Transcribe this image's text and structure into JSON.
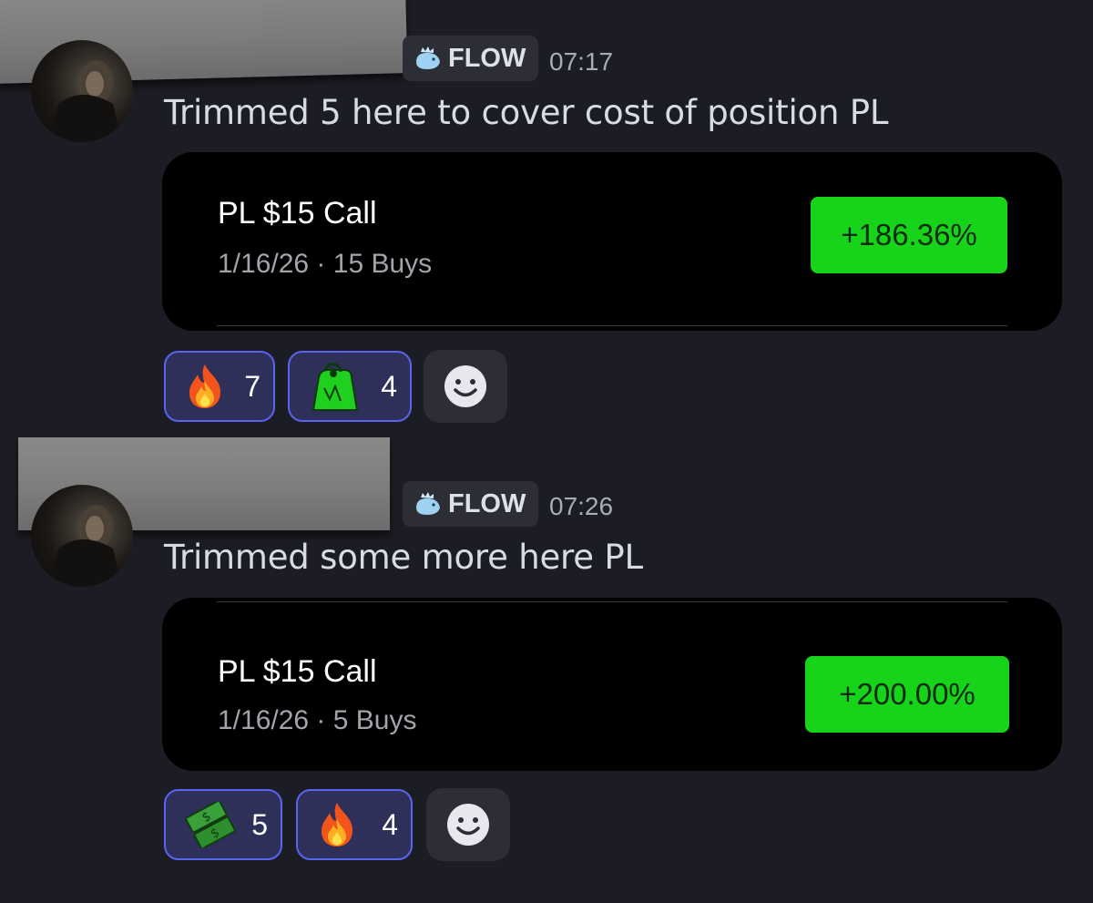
{
  "messages": [
    {
      "role_badge": "FLOW",
      "timestamp": "07:17",
      "text": "Trimmed 5 here to cover cost of position PL",
      "card": {
        "title": "PL $15 Call",
        "subtitle": "1/16/26 · 15 Buys",
        "change": "+186.36%"
      },
      "reactions": [
        {
          "emoji": "fire-emoji",
          "count": "7"
        },
        {
          "emoji": "money-bag-emoji",
          "count": "4"
        }
      ]
    },
    {
      "role_badge": "FLOW",
      "timestamp": "07:26",
      "text": "Trimmed some more here PL",
      "card": {
        "title": "PL $15 Call",
        "subtitle": "1/16/26 · 5 Buys",
        "change": "+200.00%"
      },
      "reactions": [
        {
          "emoji": "money-with-wings-emoji",
          "count": "5"
        },
        {
          "emoji": "fire-emoji",
          "count": "4"
        }
      ]
    }
  ],
  "colors": {
    "background": "#1c1d24",
    "card": "#000000",
    "gain": "#17d41a",
    "reaction_active_border": "#5865f2",
    "reaction_active_bg": "#2e305a"
  }
}
